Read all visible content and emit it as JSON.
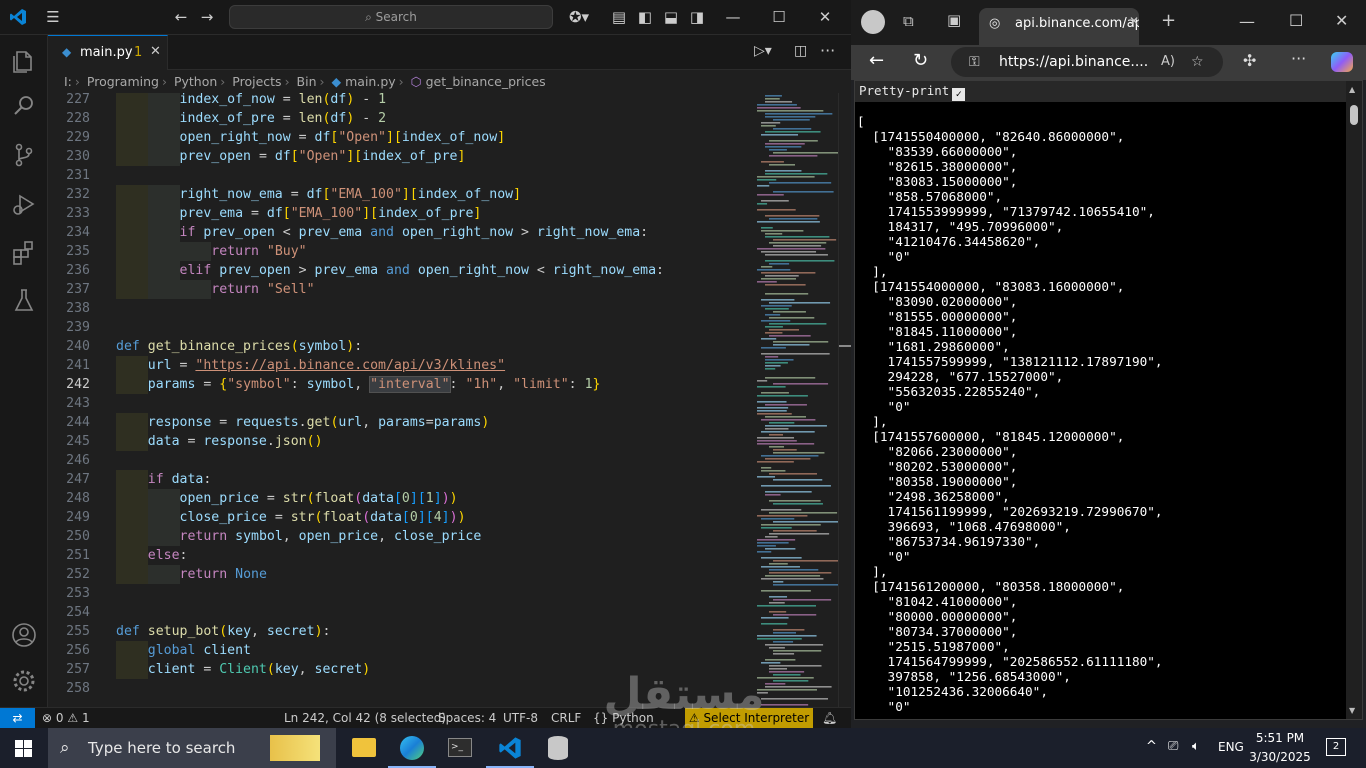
{
  "vscode": {
    "search_placeholder": "Search",
    "tab": {
      "filename": "main.py",
      "badge": "1"
    },
    "breadcrumb": [
      "I:",
      "Programing",
      "Python",
      "Projects",
      "Bin",
      "main.py",
      "get_binance_prices"
    ],
    "status": {
      "errors": "0",
      "warnings": "1",
      "cursor": "Ln 242, Col 42 (8 selected)",
      "spaces": "Spaces: 4",
      "encoding": "UTF-8",
      "eol": "CRLF",
      "language": "Python",
      "interpreter": "Select Interpreter"
    },
    "lines": [
      {
        "n": "227",
        "t": "        index_of_now = len(df) - 1"
      },
      {
        "n": "228",
        "t": "        index_of_pre = len(df) - 2"
      },
      {
        "n": "229",
        "t": "        open_right_now = df[\"Open\"][index_of_now]"
      },
      {
        "n": "230",
        "t": "        prev_open = df[\"Open\"][index_of_pre]"
      },
      {
        "n": "231",
        "t": ""
      },
      {
        "n": "232",
        "t": "        right_now_ema = df[\"EMA_100\"][index_of_now]"
      },
      {
        "n": "233",
        "t": "        prev_ema = df[\"EMA_100\"][index_of_pre]"
      },
      {
        "n": "234",
        "t": "        if prev_open < prev_ema and open_right_now > right_now_ema:"
      },
      {
        "n": "235",
        "t": "            return \"Buy\""
      },
      {
        "n": "236",
        "t": "        elif prev_open > prev_ema and open_right_now < right_now_ema:"
      },
      {
        "n": "237",
        "t": "            return \"Sell\""
      },
      {
        "n": "238",
        "t": ""
      },
      {
        "n": "239",
        "t": ""
      },
      {
        "n": "240",
        "t": "def get_binance_prices(symbol):"
      },
      {
        "n": "241",
        "t": "    url = \"https://api.binance.com/api/v3/klines\""
      },
      {
        "n": "242",
        "t": "    params = {\"symbol\": symbol, \"interval\": \"1h\", \"limit\": 1}"
      },
      {
        "n": "243",
        "t": ""
      },
      {
        "n": "244",
        "t": "    response = requests.get(url, params=params)"
      },
      {
        "n": "245",
        "t": "    data = response.json()"
      },
      {
        "n": "246",
        "t": ""
      },
      {
        "n": "247",
        "t": "    if data:"
      },
      {
        "n": "248",
        "t": "        open_price = str(float(data[0][1]))"
      },
      {
        "n": "249",
        "t": "        close_price = str(float(data[0][4]))"
      },
      {
        "n": "250",
        "t": "        return symbol, open_price, close_price"
      },
      {
        "n": "251",
        "t": "    else:"
      },
      {
        "n": "252",
        "t": "        return None"
      },
      {
        "n": "253",
        "t": ""
      },
      {
        "n": "254",
        "t": ""
      },
      {
        "n": "255",
        "t": "def setup_bot(key, secret):"
      },
      {
        "n": "256",
        "t": "    global client"
      },
      {
        "n": "257",
        "t": "    client = Client(key, secret)"
      },
      {
        "n": "258",
        "t": ""
      }
    ]
  },
  "browser": {
    "tab_title": "api.binance.com/api",
    "url": "https://api.binance....",
    "pretty_print_label": "Pretty-print",
    "json_lines": [
      "[",
      "  [1741550400000, \"82640.86000000\",",
      "    \"83539.66000000\",",
      "    \"82615.38000000\",",
      "    \"83083.15000000\",",
      "    \"858.57068000\",",
      "    1741553999999, \"71379742.10655410\",",
      "    184317, \"495.70996000\",",
      "    \"41210476.34458620\",",
      "    \"0\"",
      "  ],",
      "  [1741554000000, \"83083.16000000\",",
      "    \"83090.02000000\",",
      "    \"81555.00000000\",",
      "    \"81845.11000000\",",
      "    \"1681.29860000\",",
      "    1741557599999, \"138121112.17897190\",",
      "    294228, \"677.15527000\",",
      "    \"55632035.22855240\",",
      "    \"0\"",
      "  ],",
      "  [1741557600000, \"81845.12000000\",",
      "    \"82066.23000000\",",
      "    \"80202.53000000\",",
      "    \"80358.19000000\",",
      "    \"2498.36258000\",",
      "    1741561199999, \"202693219.72990670\",",
      "    396693, \"1068.47698000\",",
      "    \"86753734.96197330\",",
      "    \"0\"",
      "  ],",
      "  [1741561200000, \"80358.18000000\",",
      "    \"81042.41000000\",",
      "    \"80000.00000000\",",
      "    \"80734.37000000\",",
      "    \"2515.51987000\",",
      "    1741564799999, \"202586552.61111180\",",
      "    397858, \"1256.68543000\",",
      "    \"101252436.32006640\",",
      "    \"0\"",
      "  ],"
    ]
  },
  "taskbar": {
    "search_placeholder": "Type here to search",
    "language": "ENG",
    "time": "5:51 PM",
    "date": "3/30/2025",
    "notifications": "2"
  },
  "watermark": {
    "arabic": "مستقل",
    "latin": "mostaql.com"
  }
}
